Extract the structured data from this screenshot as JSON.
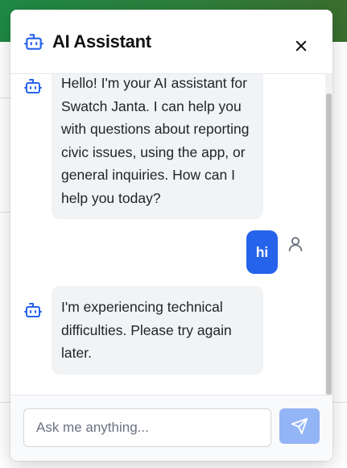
{
  "header": {
    "title": "AI Assistant",
    "bot_icon": "robot-icon",
    "close_icon": "close-icon"
  },
  "messages": [
    {
      "role": "assistant",
      "lines": [
        "Hello! I'm your AI assistant for",
        "Swatch Janta. I can help you",
        "with questions about reporting",
        "civic issues, using the app, or",
        "general inquiries. How can I",
        "help you today?"
      ]
    },
    {
      "role": "user",
      "text": "hi"
    },
    {
      "role": "assistant",
      "lines": [
        "I'm experiencing technical",
        "difficulties. Please try again",
        "later."
      ]
    }
  ],
  "composer": {
    "placeholder": "Ask me anything...",
    "value": "",
    "send_icon": "send-icon"
  },
  "colors": {
    "accent": "#2563eb",
    "send_button_disabled": "#93b4f5",
    "banner": "#2f7d3a",
    "bubble_bg": "#f1f3f5"
  }
}
